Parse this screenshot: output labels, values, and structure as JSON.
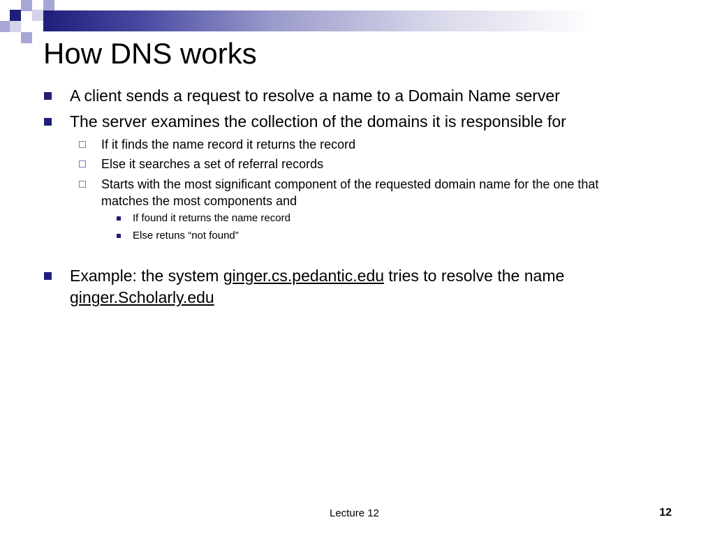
{
  "slide": {
    "title": "How DNS works",
    "bullets": {
      "b1": "A client sends a request to resolve a name to a Domain Name server",
      "b2": "The server examines the collection of the domains it is responsible for",
      "b2_1": "If it finds the name record it returns the record",
      "b2_2": "Else it searches a set of referral records",
      "b2_3_line1": "Starts with the most significant component of the requested domain name for the one that",
      "b2_3_line2": "matches the most components  and",
      "b2_3_1": "If found it returns the name record",
      "b2_3_2": "Else  retuns “not found”",
      "b3_prefix": "Example: the system ",
      "b3_link1": "ginger.cs.pedantic.edu",
      "b3_mid": " tries to resolve the name",
      "b3_link2": "ginger.Scholarly.edu"
    },
    "footer": {
      "center": "Lecture 12",
      "page_number": "12"
    }
  },
  "colors": {
    "accent_navy": "#1f1f7a",
    "accent_lavender": "#a7a7d6"
  }
}
